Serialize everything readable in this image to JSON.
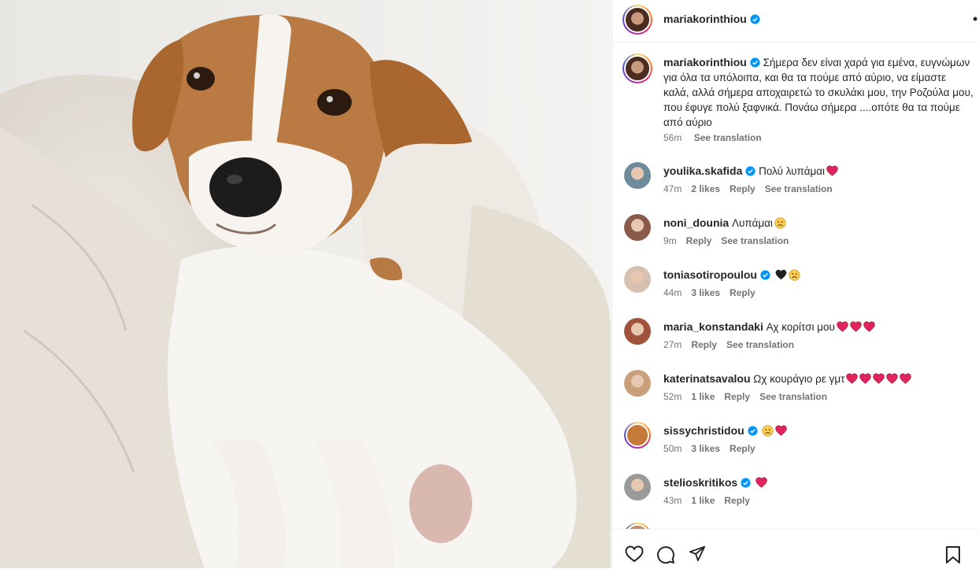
{
  "post": {
    "author": "mariakorinthiou",
    "caption": "Σήμερα δεν είναι χαρά για εμένα, ευγνώμων για όλα τα υπόλοιπα, και θα τα πούμε από αύριο, να είμαστε καλά, αλλά σήμερα αποχαιρετώ το σκυλάκι μου, την Ροζούλα μου, που έφυγε πολύ ξαφνικά. Πονάω σήμερα ....οπότε θα τα πούμε από αύριο",
    "time": "56m",
    "see_translation": "See translation"
  },
  "comments": [
    {
      "user": "youlika.skafida",
      "verified": true,
      "text": "Πολύ λυπάμαι",
      "emojis": [
        "heart"
      ],
      "time": "47m",
      "likes": "2 likes",
      "reply": "Reply",
      "translation": "See translation"
    },
    {
      "user": "noni_dounia",
      "verified": false,
      "text": "Λυπάμαι",
      "emojis": [
        "sad"
      ],
      "time": "9m",
      "likes": "",
      "reply": "Reply",
      "translation": "See translation"
    },
    {
      "user": "toniasotiropoulou",
      "verified": true,
      "text": "",
      "emojis": [
        "black-heart",
        "sad"
      ],
      "time": "44m",
      "likes": "3 likes",
      "reply": "Reply",
      "translation": ""
    },
    {
      "user": "maria_konstandaki",
      "verified": false,
      "text": "Αχ κορίτσι μου",
      "emojis": [
        "heart",
        "heart",
        "heart"
      ],
      "time": "27m",
      "likes": "",
      "reply": "Reply",
      "translation": "See translation"
    },
    {
      "user": "katerinatsavalou",
      "verified": false,
      "text": "Ωχ κουράγιο ρε γμτ",
      "emojis": [
        "heart",
        "heart",
        "heart",
        "heart",
        "heart"
      ],
      "time": "52m",
      "likes": "1 like",
      "reply": "Reply",
      "translation": "See translation"
    },
    {
      "user": "sissychristidou",
      "verified": true,
      "text": "",
      "emojis": [
        "sad",
        "heart"
      ],
      "time": "50m",
      "likes": "3 likes",
      "reply": "Reply",
      "translation": ""
    },
    {
      "user": "stelioskritikos",
      "verified": true,
      "text": "",
      "emojis": [
        "heart"
      ],
      "time": "43m",
      "likes": "1 like",
      "reply": "Reply",
      "translation": ""
    }
  ],
  "icons": {
    "like": "heart-outline-icon",
    "comment": "comment-icon",
    "share": "paper-plane-icon",
    "save": "bookmark-icon",
    "more": "more-options-icon",
    "verified": "verified-badge-icon"
  },
  "colors": {
    "verified": "#0095f6",
    "heart": "#e0245e",
    "meta": "#737373"
  }
}
